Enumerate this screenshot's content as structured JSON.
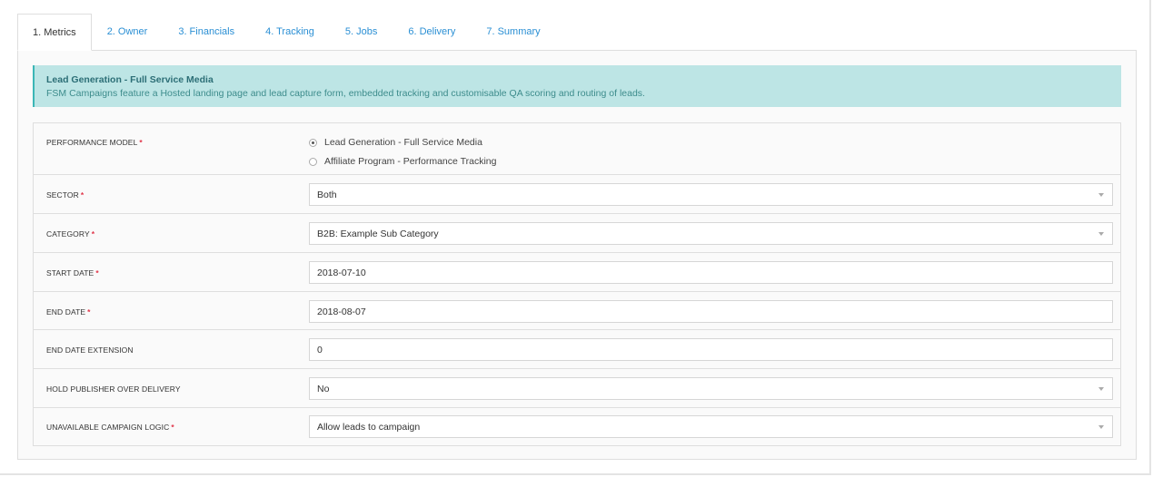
{
  "tabs": [
    {
      "label": "1. Metrics",
      "active": true
    },
    {
      "label": "2. Owner",
      "active": false
    },
    {
      "label": "3. Financials",
      "active": false
    },
    {
      "label": "4. Tracking",
      "active": false
    },
    {
      "label": "5. Jobs",
      "active": false
    },
    {
      "label": "6. Delivery",
      "active": false
    },
    {
      "label": "7. Summary",
      "active": false
    }
  ],
  "alert": {
    "title": "Lead Generation - Full Service Media",
    "text": "FSM Campaigns feature a Hosted landing page and lead capture form, embedded tracking and customisable QA scoring and routing of leads."
  },
  "form": {
    "required_mark": "*",
    "performance_model": {
      "label": "PERFORMANCE MODEL",
      "options": [
        {
          "label": "Lead Generation - Full Service Media",
          "checked": true
        },
        {
          "label": "Affiliate Program - Performance Tracking",
          "checked": false
        }
      ]
    },
    "sector": {
      "label": "SECTOR",
      "value": "Both"
    },
    "category": {
      "label": "CATEGORY",
      "value": "B2B: Example Sub Category"
    },
    "start_date": {
      "label": "START DATE",
      "value": "2018-07-10"
    },
    "end_date": {
      "label": "END DATE",
      "value": "2018-08-07"
    },
    "end_date_extension": {
      "label": "END DATE EXTENSION",
      "value": "0"
    },
    "hold_publisher": {
      "label": "HOLD PUBLISHER OVER DELIVERY",
      "value": "No"
    },
    "unavailable_logic": {
      "label": "UNAVAILABLE CAMPAIGN LOGIC",
      "value": "Allow leads to campaign"
    }
  },
  "colors": {
    "tab_link": "#2a8fd4",
    "alert_bg": "#bde5e5",
    "alert_border": "#3cb6b6",
    "required": "#e0364a"
  }
}
